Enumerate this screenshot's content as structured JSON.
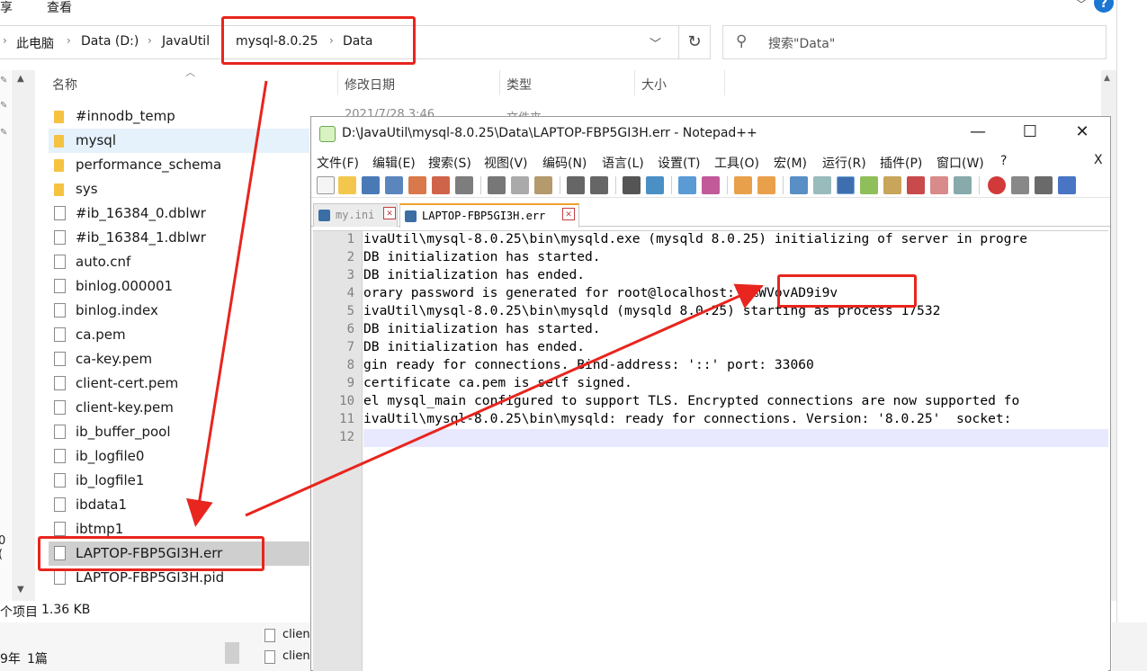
{
  "explorer": {
    "ribbon": {
      "share": "享",
      "view": "查看",
      "help": "?"
    },
    "breadcrumb": [
      "此电脑",
      "Data (D:)",
      "JavaUtil",
      "mysql-8.0.25",
      "Data"
    ],
    "search_placeholder": "搜索\"Data\"",
    "columns": {
      "name": "名称",
      "modified": "修改日期",
      "type": "类型",
      "size": "大小"
    },
    "first_row_date": "2021/7/28 3:46",
    "first_row_type": "文件夹",
    "files": [
      {
        "name": "#innodb_temp",
        "kind": "folder"
      },
      {
        "name": "mysql",
        "kind": "folder"
      },
      {
        "name": "performance_schema",
        "kind": "folder"
      },
      {
        "name": "sys",
        "kind": "folder"
      },
      {
        "name": "#ib_16384_0.dblwr",
        "kind": "file"
      },
      {
        "name": "#ib_16384_1.dblwr",
        "kind": "file"
      },
      {
        "name": "auto.cnf",
        "kind": "file"
      },
      {
        "name": "binlog.000001",
        "kind": "file"
      },
      {
        "name": "binlog.index",
        "kind": "file"
      },
      {
        "name": "ca.pem",
        "kind": "file"
      },
      {
        "name": "ca-key.pem",
        "kind": "file"
      },
      {
        "name": "client-cert.pem",
        "kind": "file"
      },
      {
        "name": "client-key.pem",
        "kind": "file"
      },
      {
        "name": "ib_buffer_pool",
        "kind": "file"
      },
      {
        "name": "ib_logfile0",
        "kind": "file"
      },
      {
        "name": "ib_logfile1",
        "kind": "file"
      },
      {
        "name": "ibdata1",
        "kind": "file"
      },
      {
        "name": "ibtmp1",
        "kind": "file"
      },
      {
        "name": "LAPTOP-FBP5GI3H.err",
        "kind": "file"
      },
      {
        "name": "LAPTOP-FBP5GI3H.pid",
        "kind": "file"
      }
    ],
    "status": {
      "count": "个项目",
      "size": "1.36 KB"
    },
    "left_cut": "0 (",
    "bottom": {
      "text1": "9年",
      "text2": "1篇"
    },
    "bg_files": [
      "client",
      "client"
    ]
  },
  "notepad": {
    "title": "D:\\JavaUtil\\mysql-8.0.25\\Data\\LAPTOP-FBP5GI3H.err - Notepad++",
    "menu": [
      "文件(F)",
      "编辑(E)",
      "搜索(S)",
      "视图(V)",
      "编码(N)",
      "语言(L)",
      "设置(T)",
      "工具(O)",
      "宏(M)",
      "运行(R)",
      "插件(P)",
      "窗口(W)",
      "?"
    ],
    "menu_close": "X",
    "tabs": [
      {
        "label": "my.ini",
        "active": false
      },
      {
        "label": "LAPTOP-FBP5GI3H.err",
        "active": true
      }
    ],
    "lines": [
      "ivaUtil\\mysql-8.0.25\\bin\\mysqld.exe (mysqld 8.0.25) initializing of server in progre",
      "DB initialization has started.",
      "DB initialization has ended.",
      "orary password is generated for root@localhost: %%WVovAD9i9v",
      "ivaUtil\\mysql-8.0.25\\bin\\mysqld (mysqld 8.0.25) starting as process 17532",
      "DB initialization has started.",
      "DB initialization has ended.",
      "gin ready for connections. Bind-address: '::' port: 33060",
      "certificate ca.pem is self signed.",
      "el mysql_main configured to support TLS. Encrypted connections are now supported fo",
      "ivaUtil\\mysql-8.0.25\\bin\\mysqld: ready for connections. Version: '8.0.25'  socket: ",
      ""
    ],
    "line_numbers": [
      "1",
      "2",
      "3",
      "4",
      "5",
      "6",
      "7",
      "8",
      "9",
      "10",
      "11",
      "12"
    ]
  },
  "colors": {
    "annotation": "#e8251e",
    "current_line": "#e8e8ff",
    "selection": "#e5f1fb"
  }
}
